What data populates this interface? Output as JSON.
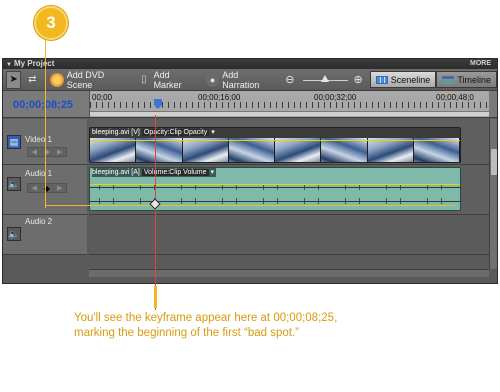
{
  "step": {
    "number": "3"
  },
  "panel": {
    "title": "My Project",
    "more_label": "MORE"
  },
  "toolbar": {
    "add_dvd_scene": "Add DVD Scene",
    "add_marker": "Add Marker",
    "add_narration": "Add Narration",
    "sceneline": "Sceneline",
    "timeline": "Timeline"
  },
  "timecode": "00;00;08;25",
  "ruler": {
    "labels": [
      "00;00",
      "00;00;16;00",
      "00;00;32;00",
      "00;00;48;0"
    ]
  },
  "tracks": {
    "video1": {
      "name": "Video 1",
      "clip_label": "bleeping.avi [V]",
      "property": "Opacity:Clip Opacity"
    },
    "audio1": {
      "name": "Audio 1",
      "clip_label": "bleeping.avi [A]",
      "property": "Volume:Clip Volume"
    },
    "audio2": {
      "name": "Audio 2"
    }
  },
  "callout": {
    "text": "You'll see the keyframe appear here at 00;00;08;25, marking the beginning of the first “bad spot.”"
  }
}
